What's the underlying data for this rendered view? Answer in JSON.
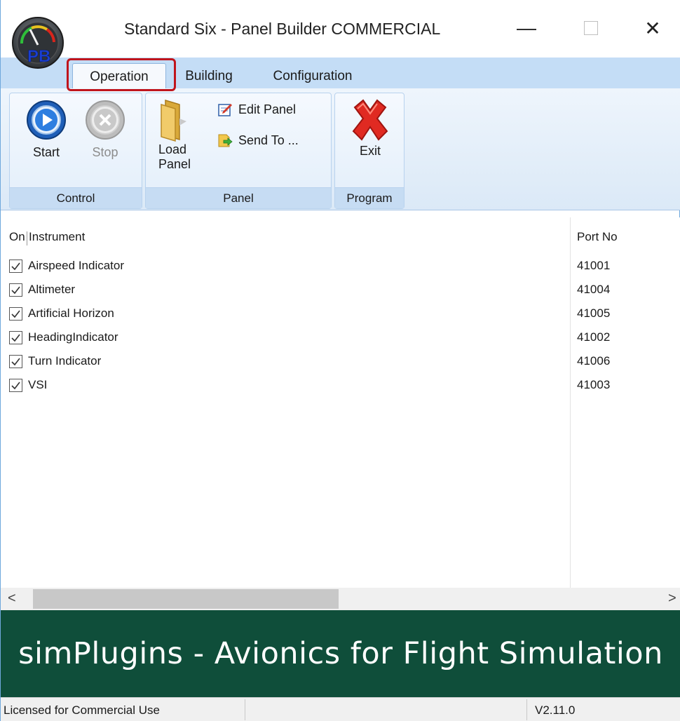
{
  "window": {
    "title": "Standard Six - Panel Builder COMMERCIAL",
    "logo_text": "PB",
    "minimize_glyph": "—",
    "close_glyph": "✕"
  },
  "tabs": [
    {
      "label": "Operation",
      "active": true
    },
    {
      "label": "Building",
      "active": false
    },
    {
      "label": "Configuration",
      "active": false
    }
  ],
  "ribbon": {
    "control": {
      "label": "Control",
      "start": {
        "label": "Start",
        "icon": "play-icon"
      },
      "stop": {
        "label": "Stop",
        "icon": "stop-icon",
        "enabled": false
      }
    },
    "panel": {
      "label": "Panel",
      "load_line1": "Load",
      "load_line2": "Panel",
      "edit": "Edit Panel",
      "send": "Send To ..."
    },
    "program": {
      "label": "Program",
      "exit": "Exit"
    }
  },
  "list": {
    "col_on": "On",
    "col_instrument": "Instrument",
    "col_port": "Port No",
    "rows": [
      {
        "checked": true,
        "name": "Airspeed Indicator",
        "port": "41001"
      },
      {
        "checked": true,
        "name": "Altimeter",
        "port": "41004"
      },
      {
        "checked": true,
        "name": "Artificial Horizon",
        "port": "41005"
      },
      {
        "checked": true,
        "name": "HeadingIndicator",
        "port": "41002"
      },
      {
        "checked": true,
        "name": "Turn Indicator",
        "port": "41006"
      },
      {
        "checked": true,
        "name": "VSI",
        "port": "41003"
      }
    ]
  },
  "scrollbar": {
    "left_arrow": "<",
    "right_arrow": ">"
  },
  "banner": "simPlugins - Avionics for Flight Simulation",
  "status": {
    "license": "Licensed for Commercial Use",
    "version": "V2.11.0"
  },
  "colors": {
    "tab_bar": "#c4ddf6",
    "banner_bg": "#0f4e3a",
    "highlight": "#c0141c"
  }
}
